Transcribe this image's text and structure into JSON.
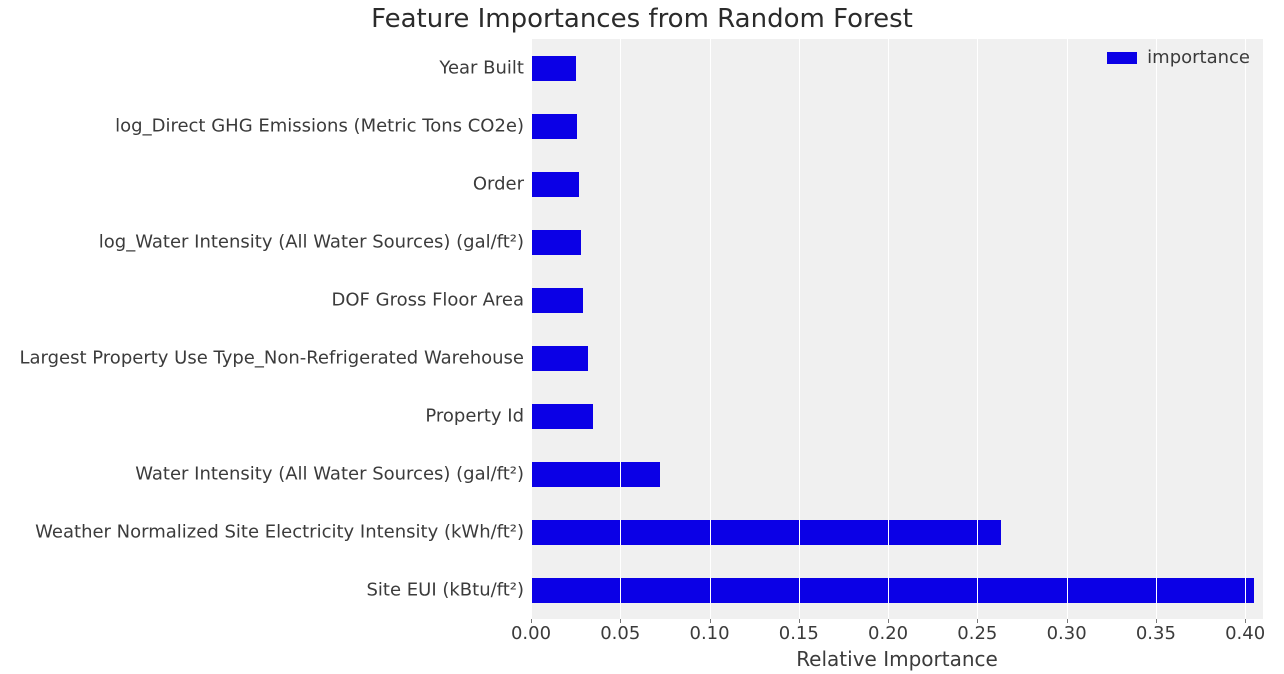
{
  "chart_data": {
    "type": "bar",
    "orientation": "horizontal",
    "title": "Feature Importances from Random Forest",
    "xlabel": "Relative Importance",
    "ylabel": "",
    "legend": {
      "items": [
        "importance"
      ],
      "position": "upper right"
    },
    "xlim": [
      0,
      0.41
    ],
    "xticks": [
      0.0,
      0.05,
      0.1,
      0.15,
      0.2,
      0.25,
      0.3,
      0.35,
      0.4
    ],
    "xtick_labels": [
      "0.00",
      "0.05",
      "0.10",
      "0.15",
      "0.20",
      "0.25",
      "0.30",
      "0.35",
      "0.40"
    ],
    "categories": [
      "Year Built",
      "log_Direct GHG Emissions (Metric Tons CO2e)",
      "Order",
      "log_Water Intensity (All Water Sources) (gal/ft²)",
      "DOF Gross Floor Area",
      "Largest Property Use Type_Non-Refrigerated Warehouse",
      "Property Id",
      "Water Intensity (All Water Sources) (gal/ft²)",
      "Weather Normalized Site Electricity Intensity (kWh/ft²)",
      "Site EUI (kBtu/ft²)"
    ],
    "values": [
      0.025,
      0.026,
      0.027,
      0.028,
      0.029,
      0.032,
      0.035,
      0.072,
      0.263,
      0.405
    ],
    "bar_color": "#0b00e6",
    "grid": true,
    "background": "#f0f0f0"
  }
}
